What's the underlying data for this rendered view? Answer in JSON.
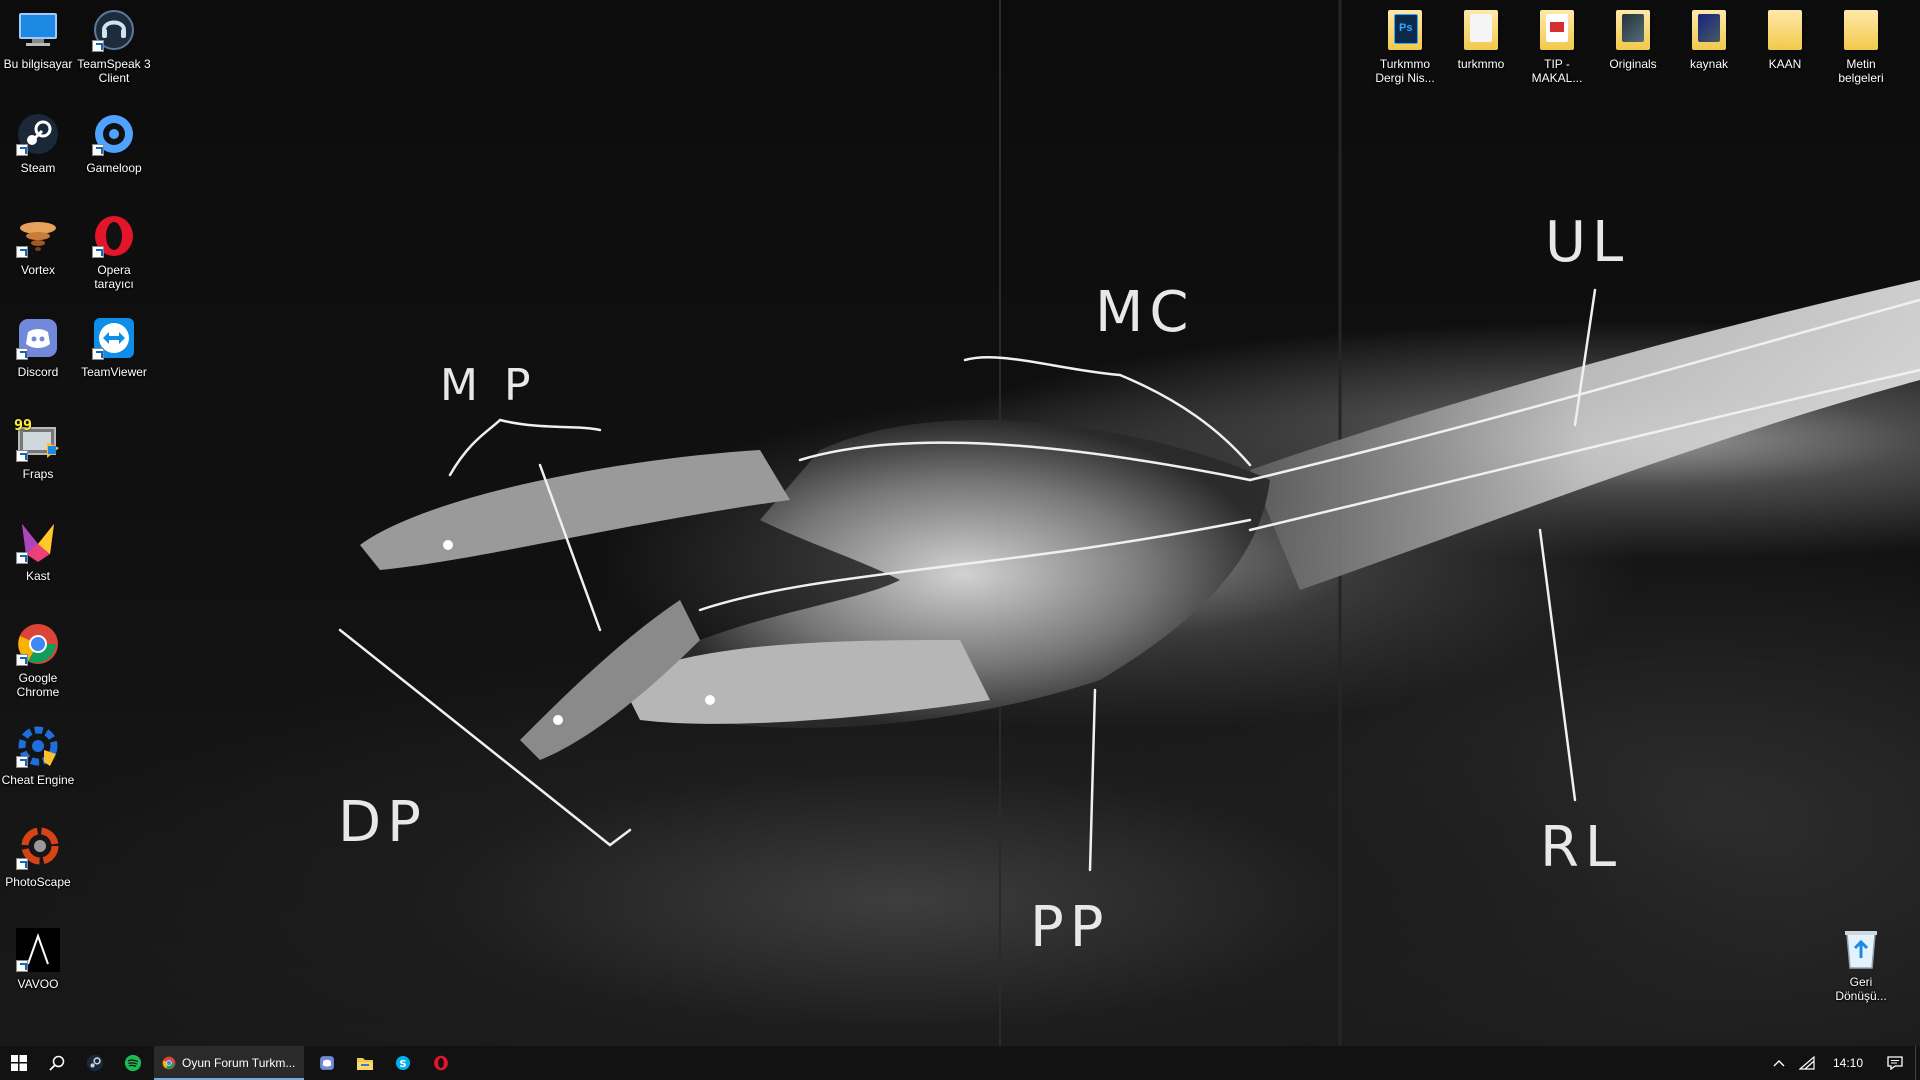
{
  "wallpaper": {
    "labels": {
      "mp": "M P",
      "mc": "MC",
      "ul": "UL",
      "dp": "DP",
      "pp": "PP",
      "rl": "RL"
    }
  },
  "desktop_left": [
    {
      "label": "Bu bilgisayar",
      "icon": "computer-icon",
      "shortcut": false
    },
    {
      "label": "TeamSpeak 3 Client",
      "icon": "teamspeak-icon",
      "shortcut": true
    },
    {
      "label": "Steam",
      "icon": "steam-icon",
      "shortcut": true
    },
    {
      "label": "Gameloop",
      "icon": "gameloop-icon",
      "shortcut": true
    },
    {
      "label": "Vortex",
      "icon": "vortex-icon",
      "shortcut": true
    },
    {
      "label": "Opera tarayıcı",
      "icon": "opera-icon",
      "shortcut": true
    },
    {
      "label": "Discord",
      "icon": "discord-icon",
      "shortcut": true
    },
    {
      "label": "TeamViewer",
      "icon": "teamviewer-icon",
      "shortcut": true
    },
    {
      "label": "Fraps",
      "icon": "fraps-icon",
      "shortcut": true,
      "badge": "99"
    },
    {
      "label": "Kast",
      "icon": "kast-icon",
      "shortcut": true
    },
    {
      "label": "Google Chrome",
      "icon": "chrome-icon",
      "shortcut": true
    },
    {
      "label": "Cheat Engine",
      "icon": "cheat-engine-icon",
      "shortcut": true
    },
    {
      "label": "PhotoScape",
      "icon": "photoscape-icon",
      "shortcut": true
    },
    {
      "label": "VAVOO",
      "icon": "vavoo-icon",
      "shortcut": true
    }
  ],
  "desktop_right": [
    {
      "label": "Turkmmo Dergi Nis...",
      "icon": "folder-photoshop-icon"
    },
    {
      "label": "turkmmo",
      "icon": "folder-icon"
    },
    {
      "label": "TIP - MAKAL...",
      "icon": "folder-pdf-icon"
    },
    {
      "label": "Originals",
      "icon": "folder-images-icon"
    },
    {
      "label": "kaynak",
      "icon": "folder-images-icon"
    },
    {
      "label": "KAAN",
      "icon": "folder-icon"
    },
    {
      "label": "Metin belgeleri",
      "icon": "folder-icon"
    }
  ],
  "recycle_bin": {
    "label": "Geri Dönüşü...",
    "icon": "recycle-bin-icon"
  },
  "taskbar": {
    "start": "start-icon",
    "search": "search-icon",
    "pinned": [
      "steam-icon",
      "spotify-icon"
    ],
    "chrome_task": {
      "label": "Oyun Forum Turkm...",
      "icon": "chrome-icon"
    },
    "pinned_after": [
      "discord-icon",
      "file-explorer-icon",
      "skype-icon",
      "opera-icon"
    ],
    "tray": {
      "chevron": "chevron-up-icon",
      "network": "network-icon",
      "time": "14:10",
      "notifications": "notification-icon"
    }
  },
  "colors": {
    "taskbar": "#121212",
    "accent": "#7aa7d6"
  }
}
